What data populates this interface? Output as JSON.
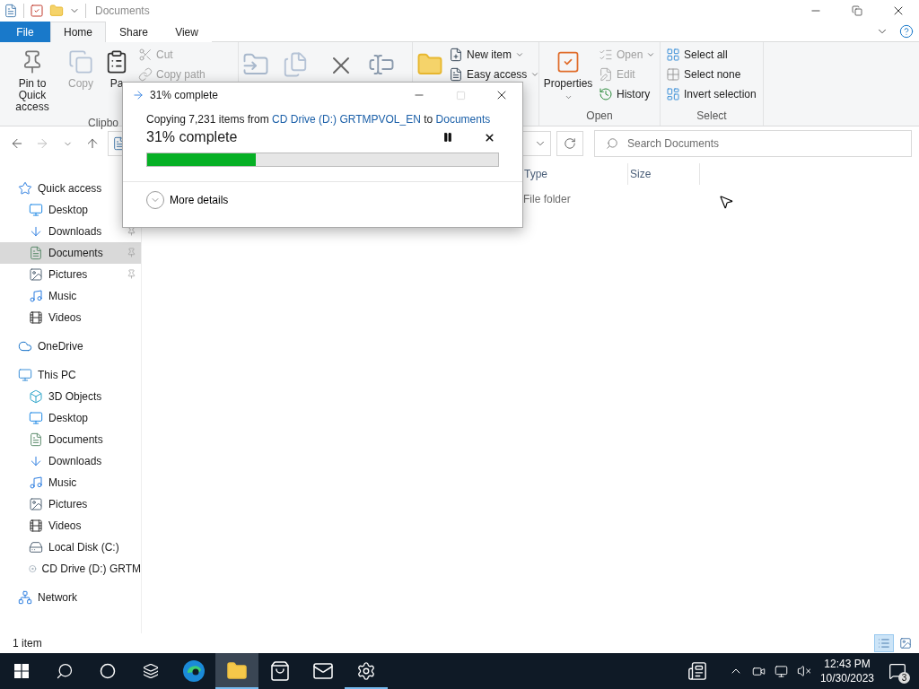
{
  "window": {
    "title": "Documents"
  },
  "ribbon_tabs": [
    {
      "label": "File",
      "kind": "file",
      "selected": false
    },
    {
      "label": "Home",
      "kind": "tab",
      "selected": true
    },
    {
      "label": "Share",
      "kind": "tab",
      "selected": false
    },
    {
      "label": "View",
      "kind": "tab",
      "selected": false
    }
  ],
  "ribbon": {
    "clipboard": {
      "label": "Clipbo",
      "pin": {
        "label": "Pin to Quick access",
        "disabled": false
      },
      "copy": {
        "label": "Copy",
        "disabled": true
      },
      "paste": {
        "label": "Pa",
        "disabled": false
      },
      "cut": {
        "label": "Cut",
        "disabled": true
      },
      "copy_path": {
        "label": "Copy path",
        "disabled": true
      }
    },
    "new": {
      "new_item": {
        "label": "New item",
        "disabled": false
      },
      "easy_access": {
        "label": "Easy access",
        "disabled": false
      }
    },
    "open": {
      "label": "Open",
      "properties": {
        "label": "Properties",
        "disabled": false
      },
      "open": {
        "label": "Open",
        "disabled": true
      },
      "edit": {
        "label": "Edit",
        "disabled": true
      },
      "history": {
        "label": "History",
        "disabled": false
      }
    },
    "select": {
      "label": "Select",
      "select_all": {
        "label": "Select all",
        "disabled": false
      },
      "select_none": {
        "label": "Select none",
        "disabled": false
      },
      "invert_selection": {
        "label": "Invert selection",
        "disabled": false
      }
    }
  },
  "search": {
    "placeholder": "Search Documents"
  },
  "columns": [
    "Type",
    "Size"
  ],
  "rows": [
    {
      "type": "File folder"
    }
  ],
  "sidebar": [
    {
      "label": "Quick access",
      "kind": "star",
      "selected": false,
      "children": [
        {
          "label": "Desktop",
          "kind": "desktop",
          "selected": false
        },
        {
          "label": "Downloads",
          "kind": "downloads",
          "selected": false,
          "pinned": true
        },
        {
          "label": "Documents",
          "kind": "documents",
          "selected": true,
          "pinned": true
        },
        {
          "label": "Pictures",
          "kind": "pictures",
          "selected": false,
          "pinned": true
        },
        {
          "label": "Music",
          "kind": "music",
          "selected": false,
          "pinned": false
        },
        {
          "label": "Videos",
          "kind": "videos",
          "selected": false,
          "pinned": false
        }
      ]
    },
    {
      "label": "OneDrive",
      "kind": "cloud",
      "selected": false
    },
    {
      "label": "This PC",
      "kind": "pc",
      "selected": false,
      "children": [
        {
          "label": "3D Objects",
          "kind": "objects",
          "selected": false
        },
        {
          "label": "Desktop",
          "kind": "desktop",
          "selected": false
        },
        {
          "label": "Documents",
          "kind": "documents",
          "selected": false
        },
        {
          "label": "Downloads",
          "kind": "downloads",
          "selected": false
        },
        {
          "label": "Music",
          "kind": "music",
          "selected": false
        },
        {
          "label": "Pictures",
          "kind": "pictures",
          "selected": false
        },
        {
          "label": "Videos",
          "kind": "videos",
          "selected": false
        },
        {
          "label": "Local Disk (C:)",
          "kind": "disk",
          "selected": false
        },
        {
          "label": "CD Drive (D:) GRTM",
          "kind": "cd",
          "selected": false
        }
      ]
    },
    {
      "label": "Network",
      "kind": "network",
      "selected": false
    }
  ],
  "status_bar": {
    "count": "1 item",
    "views": [
      {
        "kind": "details",
        "selected": true
      },
      {
        "kind": "large",
        "selected": false
      }
    ]
  },
  "dialog": {
    "title": "31% complete",
    "maximize_disabled": true,
    "message": {
      "prefix": "Copying 7,231 items from ",
      "source": "CD Drive (D:) GRTMPVOL_EN",
      "middle": " to ",
      "destination": "Documents"
    },
    "heading": "31% complete",
    "level": 0.31,
    "more_details": "More details"
  },
  "taskbar": {
    "apps": [
      {
        "kind": "edge",
        "selected": false,
        "running": false
      },
      {
        "kind": "explorer",
        "selected": true,
        "running": true
      },
      {
        "kind": "store",
        "selected": false,
        "running": false
      },
      {
        "kind": "mail",
        "selected": false,
        "running": false
      },
      {
        "kind": "settings",
        "selected": false,
        "running": true
      }
    ],
    "muted": true,
    "time": "12:43 PM",
    "date": "10/30/2023",
    "notifications": "3"
  }
}
